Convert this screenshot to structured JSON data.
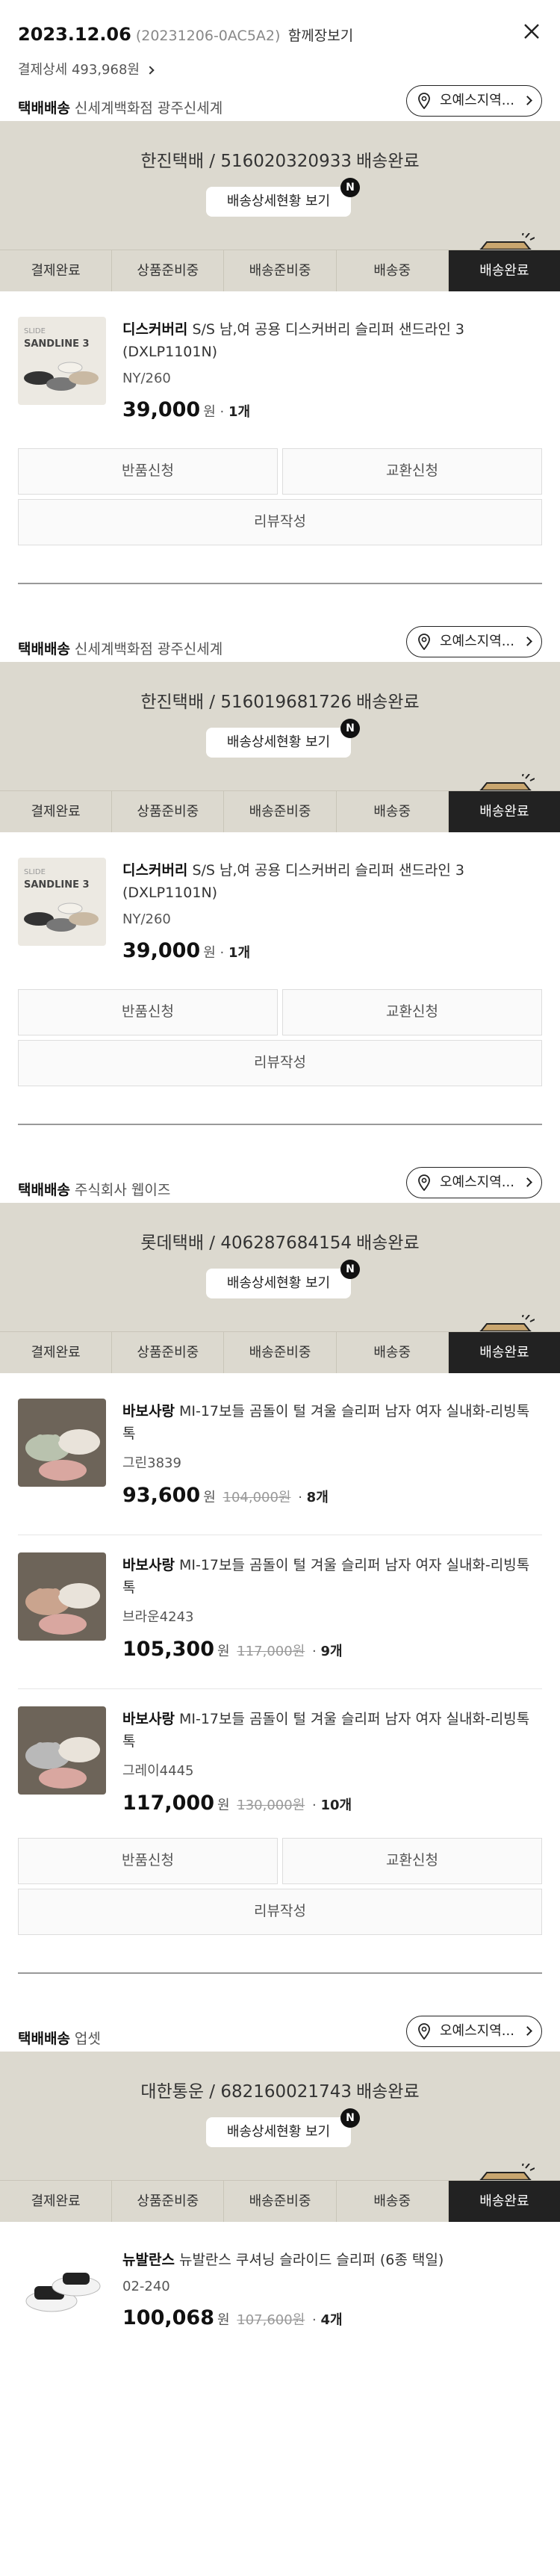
{
  "header": {
    "date": "2023.12.06",
    "order_id": "(20231206-0AC5A2)",
    "group_label": "함께장보기",
    "payment_detail": "결제상세 493,968원"
  },
  "steps": [
    "결제완료",
    "상품준비중",
    "배송준비중",
    "배송중",
    "배송완료"
  ],
  "tracking_button": "배송상세현황 보기",
  "new_badge": "N",
  "orders": [
    {
      "ship_type": "택배배송",
      "seller": "신세계백화점 광주신세계",
      "store_button": "오예스지역...",
      "courier": "한진택배 / 516020320933",
      "status": "배송완료",
      "items": [
        {
          "brand": "디스커버리",
          "name": "S/S 남,여 공용 디스커버리 슬리퍼 샌드라인 3 (DXLP1101N)",
          "option": "NY/260",
          "price": "39,000",
          "unit": "원",
          "orig": "",
          "qty": "1개",
          "thumb": "sandline"
        }
      ],
      "buttons": [
        "반품신청",
        "교환신청",
        "리뷰작성"
      ]
    },
    {
      "ship_type": "택배배송",
      "seller": "신세계백화점 광주신세계",
      "store_button": "오예스지역...",
      "courier": "한진택배 / 516019681726",
      "status": "배송완료",
      "items": [
        {
          "brand": "디스커버리",
          "name": "S/S 남,여 공용 디스커버리 슬리퍼 샌드라인 3 (DXLP1101N)",
          "option": "NY/260",
          "price": "39,000",
          "unit": "원",
          "orig": "",
          "qty": "1개",
          "thumb": "sandline"
        }
      ],
      "buttons": [
        "반품신청",
        "교환신청",
        "리뷰작성"
      ]
    },
    {
      "ship_type": "택배배송",
      "seller": "주식회사 웹이즈",
      "store_button": "오예스지역...",
      "courier": "롯데택배 / 406287684154",
      "status": "배송완료",
      "items": [
        {
          "brand": "바보사랑",
          "name": "MI-17보들 곰돌이 털 겨울 슬리퍼 남자 여자 실내화-리빙톡톡",
          "option": "그린3839",
          "price": "93,600",
          "unit": "원",
          "orig": "104,000원",
          "qty": "8개",
          "thumb": "bear-green"
        },
        {
          "brand": "바보사랑",
          "name": "MI-17보들 곰돌이 털 겨울 슬리퍼 남자 여자 실내화-리빙톡톡",
          "option": "브라운4243",
          "price": "105,300",
          "unit": "원",
          "orig": "117,000원",
          "qty": "9개",
          "thumb": "bear-brown"
        },
        {
          "brand": "바보사랑",
          "name": "MI-17보들 곰돌이 털 겨울 슬리퍼 남자 여자 실내화-리빙톡톡",
          "option": "그레이4445",
          "price": "117,000",
          "unit": "원",
          "orig": "130,000원",
          "qty": "10개",
          "thumb": "bear-gray"
        }
      ],
      "buttons": [
        "반품신청",
        "교환신청",
        "리뷰작성"
      ]
    },
    {
      "ship_type": "택배배송",
      "seller": "업셋",
      "store_button": "오예스지역...",
      "courier": "대한통운 / 682160021743",
      "status": "배송완료",
      "items": [
        {
          "brand": "뉴발란스",
          "name": "뉴발란스 쿠셔닝 슬라이드 슬리퍼 (6종 택일)",
          "option": "02-240",
          "price": "100,068",
          "unit": "원",
          "orig": "107,600원",
          "qty": "4개",
          "thumb": "nb"
        }
      ],
      "buttons": []
    }
  ],
  "colors": {
    "track_bg": "#dcd9cf",
    "active_step": "#222222",
    "box": "#d8b77f"
  }
}
